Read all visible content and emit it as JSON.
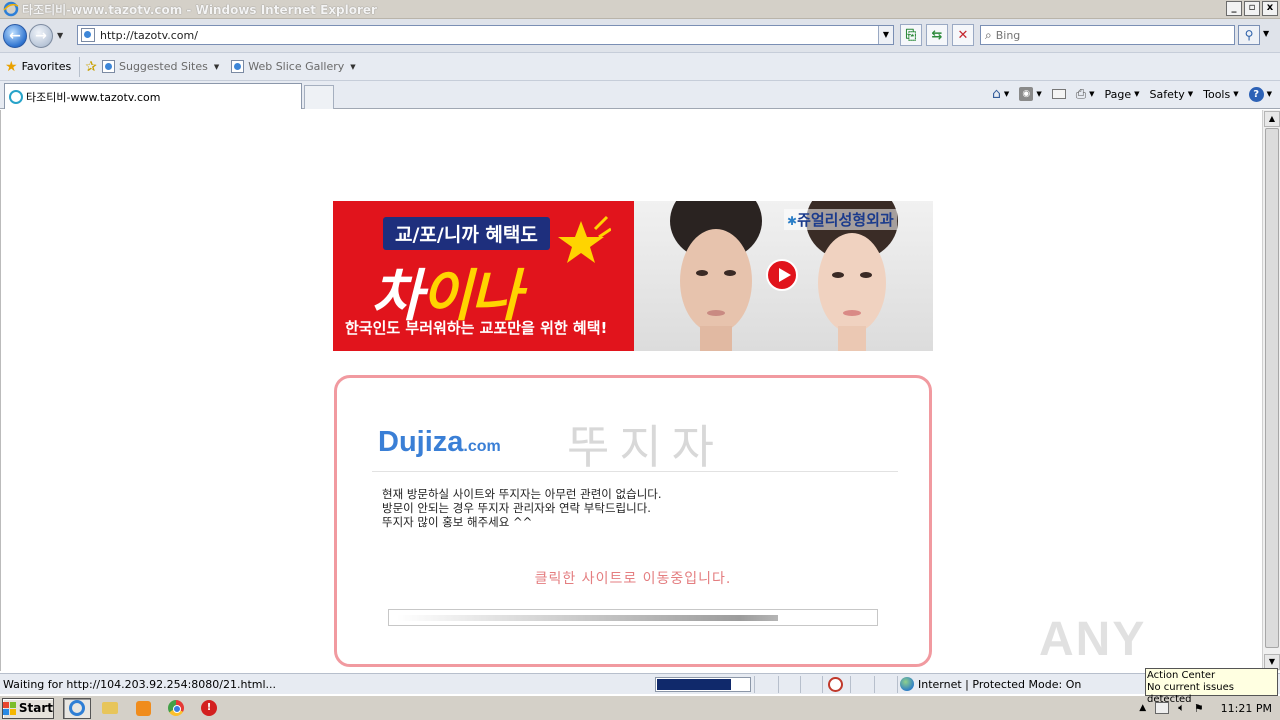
{
  "window": {
    "title": "타조티비-www.tazotv.com - Windows Internet Explorer",
    "controls": [
      "_",
      "▫",
      "x"
    ]
  },
  "address_bar": {
    "url": "http://tazotv.com/",
    "search_placeholder": "Bing"
  },
  "favorites_bar": {
    "favorites_label": "Favorites",
    "suggested_sites_label": "Suggested Sites",
    "web_slice_label": "Web Slice Gallery"
  },
  "tab": {
    "label": "타조티비-www.tazotv.com"
  },
  "command_bar": {
    "page_label": "Page",
    "safety_label": "Safety",
    "tools_label": "Tools"
  },
  "banner": {
    "pill_text": "교/포/니까 혜택도",
    "headline_part1": "차",
    "headline_part2": "이나",
    "subline": "한국인도 부러워하는 교포만을 위한 혜택!",
    "clinic_mark": "✱",
    "clinic_name": "쥬얼리성형외과"
  },
  "card": {
    "brand_main": "Dujiza",
    "brand_suffix": ".com",
    "brand_korean": "뚜지자",
    "message_lines": [
      "현재 방문하실 사이트와 뚜지자는 아무런 관련이 없습니다.",
      "방문이 안되는 경우 뚜지자 관리자와 연락 부탁드립니다.",
      "뚜지자 많이 홍보 해주세요 ^^"
    ],
    "moving_text": "클릭한 사이트로 이동중입니다.",
    "progress_fraction": 0.78
  },
  "watermark": "ANY RUN",
  "status_bar": {
    "status_text": "Waiting for http://104.203.92.254:8080/21.html...",
    "load_progress_fraction": 0.77,
    "zone_text": "Internet | Protected Mode: On"
  },
  "action_center": {
    "title": "Action Center",
    "text": "No current issues detected"
  },
  "taskbar": {
    "start_label": "Start",
    "clock": "11:21 PM"
  },
  "colors": {
    "brand_blue": "#3a7fd6",
    "card_border": "#f19aa0",
    "moving_text": "#e47e80",
    "banner_red": "#e1141c"
  }
}
